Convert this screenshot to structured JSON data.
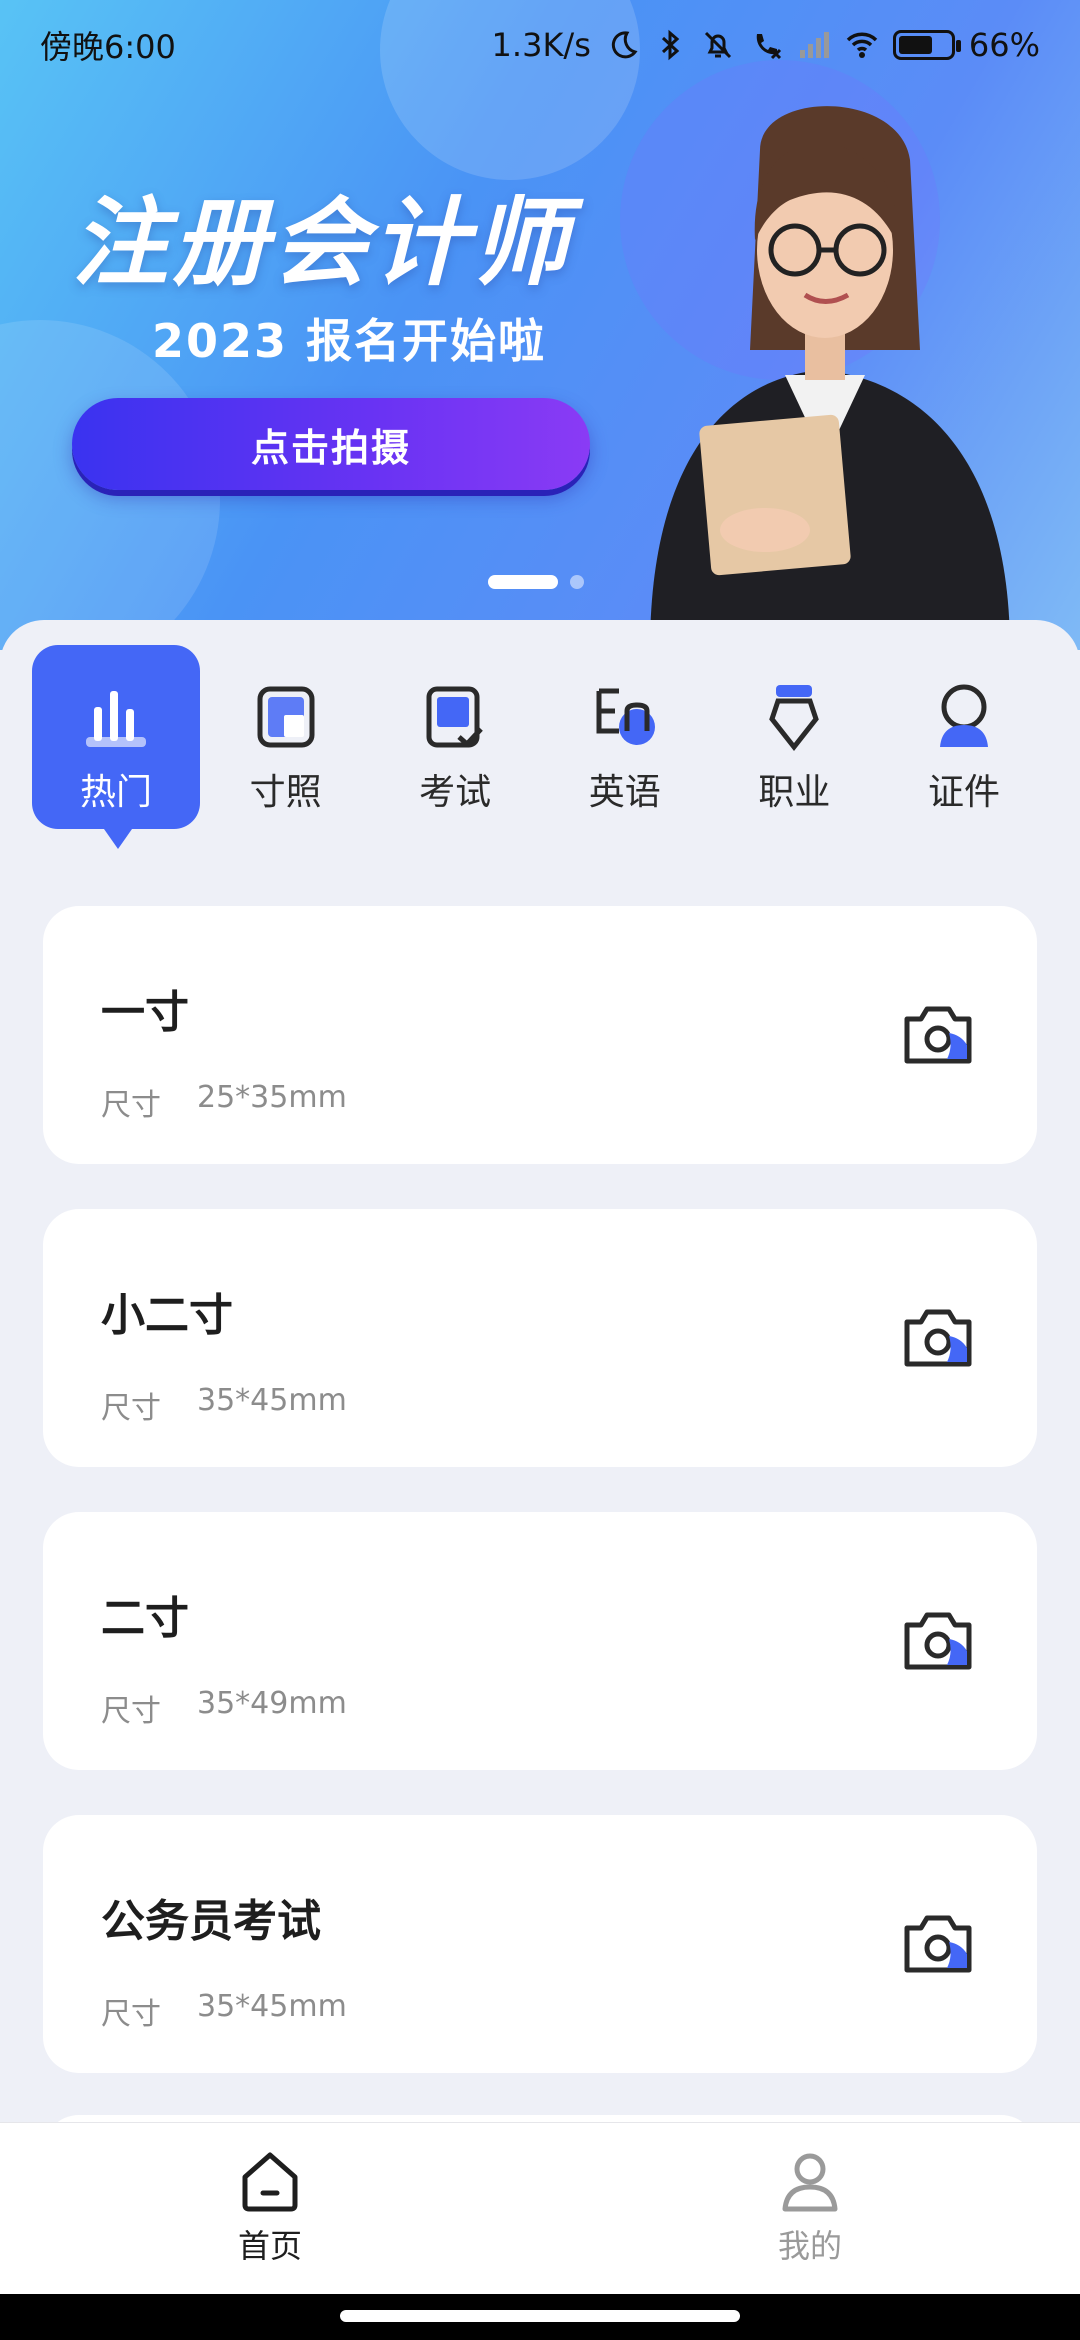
{
  "status_bar": {
    "time": "傍晚6:00",
    "net_speed": "1.3K/s",
    "battery": "66%",
    "battery_level": 0.66,
    "icons": [
      "moon-icon",
      "bluetooth-icon",
      "mute-bell-icon",
      "call-blocked-icon",
      "signal-icon",
      "wifi-icon",
      "battery-icon"
    ]
  },
  "banner": {
    "title": "注册会计师",
    "subtitle": "2023 报名开始啦",
    "button": "点击拍摄",
    "page_count": 2,
    "active_page": 1
  },
  "categories": [
    {
      "label": "热门",
      "icon": "chart-bars-icon",
      "active": true
    },
    {
      "label": "寸照",
      "icon": "photo-frame-icon",
      "active": false
    },
    {
      "label": "考试",
      "icon": "exam-check-icon",
      "active": false
    },
    {
      "label": "英语",
      "icon": "english-en-icon",
      "active": false
    },
    {
      "label": "职业",
      "icon": "badge-icon",
      "active": false
    },
    {
      "label": "证件",
      "icon": "person-id-icon",
      "active": false
    }
  ],
  "items": [
    {
      "name": "一寸",
      "size_label": "尺寸",
      "size": "25*35mm"
    },
    {
      "name": "小二寸",
      "size_label": "尺寸",
      "size": "35*45mm"
    },
    {
      "name": "二寸",
      "size_label": "尺寸",
      "size": "35*49mm"
    },
    {
      "name": "公务员考试",
      "size_label": "尺寸",
      "size": "35*45mm"
    }
  ],
  "tabs": [
    {
      "label": "首页",
      "icon": "home-icon",
      "active": true
    },
    {
      "label": "我的",
      "icon": "user-icon",
      "active": false
    }
  ],
  "colors": {
    "accent": "#4467f6",
    "button_gradient_start": "#3a33f0",
    "button_gradient_end": "#8a3bf5",
    "banner_bg": "#4a93f5"
  }
}
